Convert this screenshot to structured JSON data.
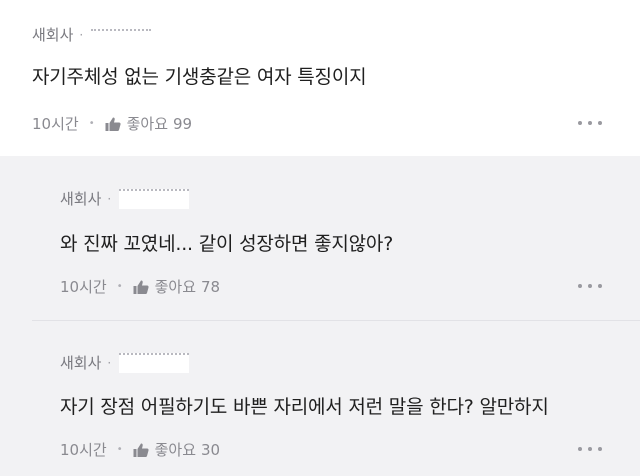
{
  "comment": {
    "company": "새회사",
    "text": "자기주체성 없는 기생충같은 여자 특징이지",
    "time": "10시간",
    "like_label": "좋아요",
    "like_count": "99"
  },
  "replies": [
    {
      "company": "새회사",
      "text": "와 진짜 꼬였네... 같이 성장하면 좋지않아?",
      "time": "10시간",
      "like_label": "좋아요",
      "like_count": "78"
    },
    {
      "company": "새회사",
      "text": "자기 장점 어필하기도 바쁜 자리에서 저런 말을 한다? 알만하지",
      "time": "10시간",
      "like_label": "좋아요",
      "like_count": "30"
    }
  ],
  "icons": {
    "like": "thumbs-up-icon",
    "more": "more-options-icon"
  },
  "colors": {
    "reply_background": "#f2f2f4",
    "secondary_text": "#8a8a90"
  }
}
